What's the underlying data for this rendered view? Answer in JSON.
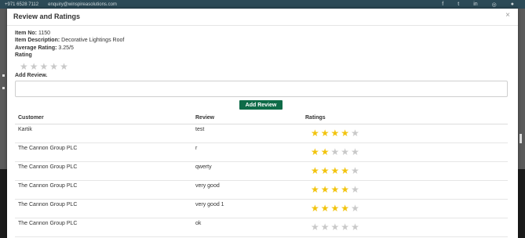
{
  "topbar": {
    "phone": "+971 6528 7112",
    "email": "enquiry@winspireasolutions.com",
    "social": [
      "f",
      "t",
      "in",
      "◎",
      "●"
    ]
  },
  "modal": {
    "title": "Review and Ratings",
    "close": "×",
    "item_no_label": "Item No:",
    "item_no": "1150",
    "item_desc_label": "Item Description:",
    "item_desc": "Decorative Lightings Roof",
    "avg_label": "Average Rating:",
    "avg_value": "3.25/5",
    "rating_label": "Rating",
    "rating_value": 0,
    "add_review_label": "Add Review.",
    "review_value": "",
    "add_button": "Add Review"
  },
  "table": {
    "headers": [
      "Customer",
      "Review",
      "Ratings"
    ],
    "rows": [
      {
        "customer": "Kartik",
        "review": "test",
        "rating": 4
      },
      {
        "customer": "The Cannon Group PLC",
        "review": "r",
        "rating": 2
      },
      {
        "customer": "The Cannon Group PLC",
        "review": "qwerty",
        "rating": 4
      },
      {
        "customer": "The Cannon Group PLC",
        "review": "very good",
        "rating": 4
      },
      {
        "customer": "The Cannon Group PLC",
        "review": "very good 1",
        "rating": 4
      },
      {
        "customer": "The Cannon Group PLC",
        "review": "ok",
        "rating": 0
      }
    ]
  },
  "colors": {
    "star_on": "#f2c40e",
    "star_off": "#c9c9c9",
    "button_bg": "#0f6b48"
  }
}
